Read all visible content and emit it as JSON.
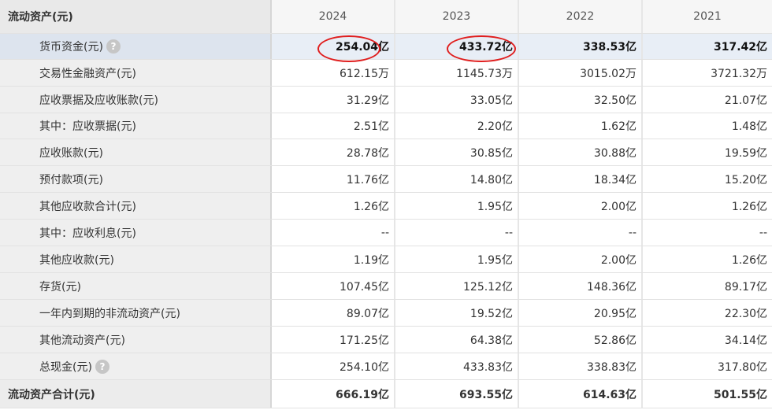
{
  "header": {
    "section_label": "流动资产(元)",
    "years": [
      "2024",
      "2023",
      "2022",
      "2021"
    ]
  },
  "rows": [
    {
      "label": "货币资金(元)",
      "values": [
        "254.04亿",
        "433.72亿",
        "338.53亿",
        "317.42亿"
      ],
      "help": "?"
    },
    {
      "label": "交易性金融资产(元)",
      "values": [
        "612.15万",
        "1145.73万",
        "3015.02万",
        "3721.32万"
      ]
    },
    {
      "label": "应收票据及应收账款(元)",
      "values": [
        "31.29亿",
        "33.05亿",
        "32.50亿",
        "21.07亿"
      ]
    },
    {
      "label": "其中：应收票据(元)",
      "values": [
        "2.51亿",
        "2.20亿",
        "1.62亿",
        "1.48亿"
      ]
    },
    {
      "label": "应收账款(元)",
      "values": [
        "28.78亿",
        "30.85亿",
        "30.88亿",
        "19.59亿"
      ]
    },
    {
      "label": "预付款项(元)",
      "values": [
        "11.76亿",
        "14.80亿",
        "18.34亿",
        "15.20亿"
      ]
    },
    {
      "label": "其他应收款合计(元)",
      "values": [
        "1.26亿",
        "1.95亿",
        "2.00亿",
        "1.26亿"
      ]
    },
    {
      "label": "其中：应收利息(元)",
      "values": [
        "--",
        "--",
        "--",
        "--"
      ]
    },
    {
      "label": "其他应收款(元)",
      "values": [
        "1.19亿",
        "1.95亿",
        "2.00亿",
        "1.26亿"
      ]
    },
    {
      "label": "存货(元)",
      "values": [
        "107.45亿",
        "125.12亿",
        "148.36亿",
        "89.17亿"
      ]
    },
    {
      "label": "一年内到期的非流动资产(元)",
      "values": [
        "89.07亿",
        "19.52亿",
        "20.95亿",
        "22.30亿"
      ]
    },
    {
      "label": "其他流动资产(元)",
      "values": [
        "171.25亿",
        "64.38亿",
        "52.86亿",
        "34.14亿"
      ]
    },
    {
      "label": "总现金(元)",
      "values": [
        "254.10亿",
        "433.83亿",
        "338.83亿",
        "317.80亿"
      ],
      "help": "?"
    }
  ],
  "total": {
    "label": "流动资产合计(元)",
    "values": [
      "666.19亿",
      "693.55亿",
      "614.63亿",
      "501.55亿"
    ]
  },
  "colors": {
    "annotation_circle": "#e01e1e",
    "highlight_row_bg": "#e8eef6"
  }
}
